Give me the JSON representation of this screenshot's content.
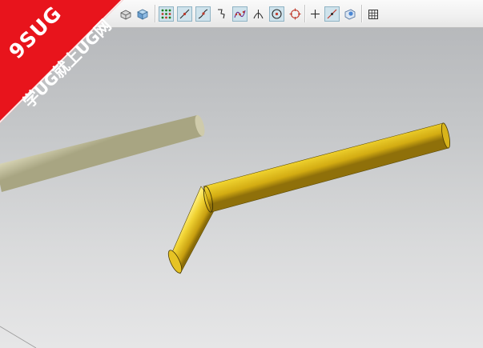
{
  "watermark": {
    "logo": "9SUG",
    "slogan": "学UG就上UG网",
    "color": "#e8141c"
  },
  "colors": {
    "background_top": "#b3b5b8",
    "background_bottom": "#e6e6e7",
    "selected_tube": "#e2c426",
    "ghost_tube": "#cbc8a6",
    "toolbar_pressed": "#cfe3ec"
  },
  "toolbar": {
    "icons": [
      "shaded-box-icon",
      "solid-cube-icon",
      "snap-endpoint-icon",
      "snap-line-icon",
      "snap-curve-icon",
      "snap-spline-icon",
      "snap-control-point-icon",
      "snap-intersection-icon",
      "snap-arc-center-icon",
      "snap-quadrant-icon",
      "snap-existing-point-icon",
      "snap-point-on-curve-icon",
      "snap-point-on-face-icon",
      "grid-icon"
    ]
  }
}
